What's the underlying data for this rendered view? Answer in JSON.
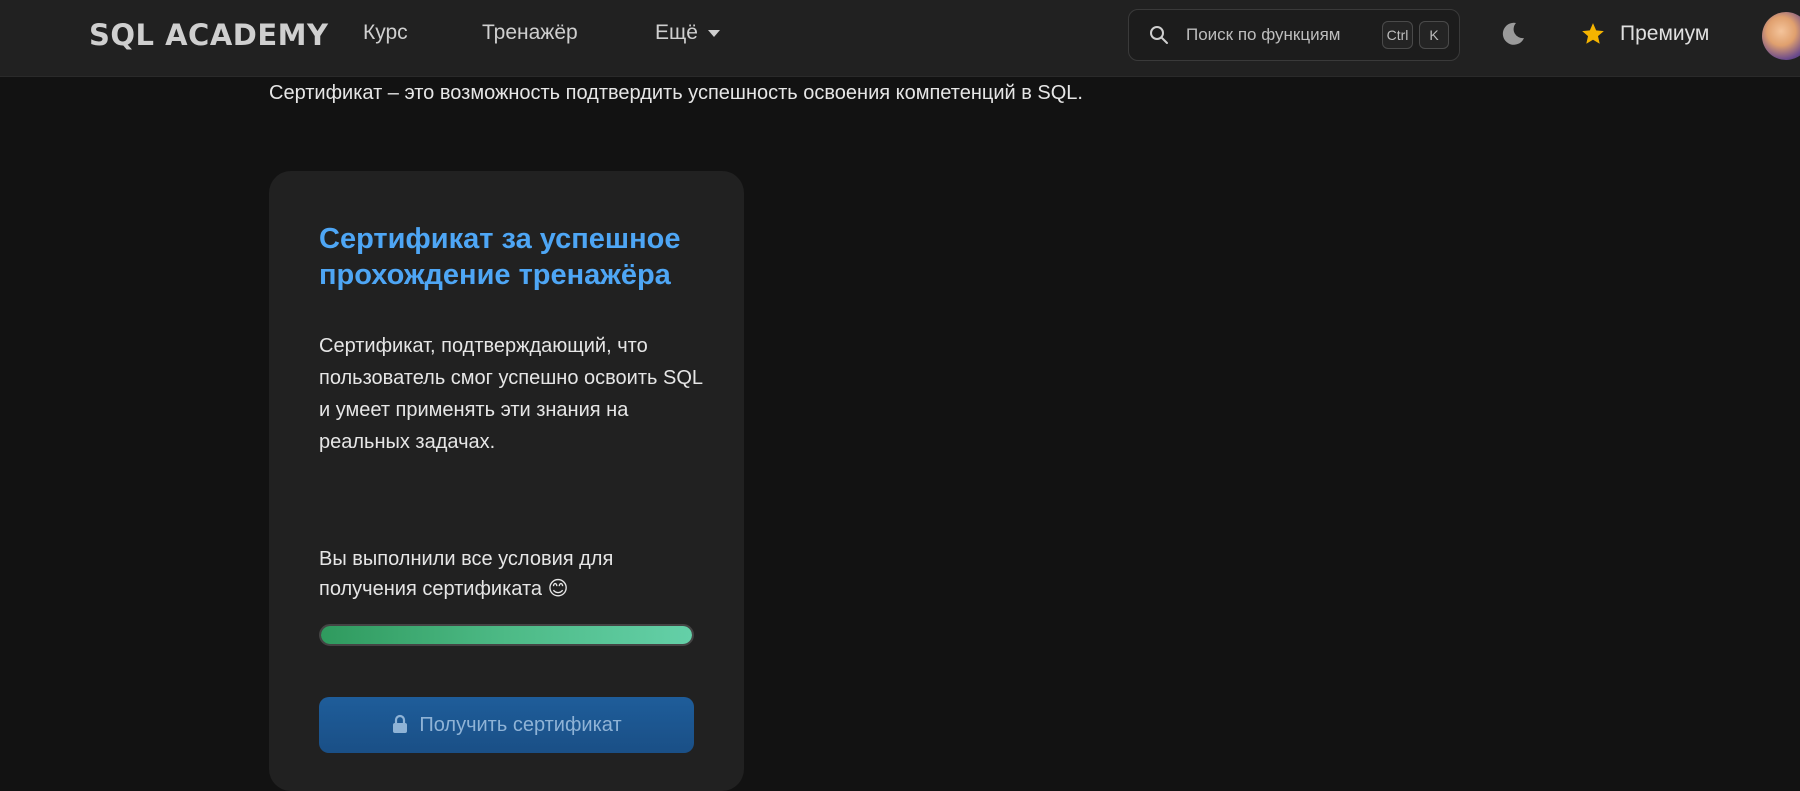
{
  "header": {
    "logo": "SQL ACADEMY",
    "nav": {
      "course": "Курс",
      "trainer": "Тренажёр",
      "more": "Ещё"
    },
    "search": {
      "placeholder": "Поиск по функциям",
      "shortcut_ctrl": "Ctrl",
      "shortcut_key": "K"
    },
    "premium_label": "Премиум"
  },
  "intro_text": "Сертификат – это возможность подтвердить успешность освоения компетенций в SQL.",
  "card": {
    "title": "Сертификат за успешное прохождение тренажёра",
    "description": "Сертификат, подтверждающий, что пользователь смог успешно освоить SQL и умеет применять эти знания на реальных задачах.",
    "status": "Вы выполнили все условия для получения сертификата 😊",
    "progress_percent": 100,
    "button_label": "Получить сертификат"
  },
  "colors": {
    "accent_blue": "#4ea6f5",
    "progress_green": "#4dba86",
    "button_blue": "#1e5d9a",
    "premium_star": "#f5b400"
  }
}
